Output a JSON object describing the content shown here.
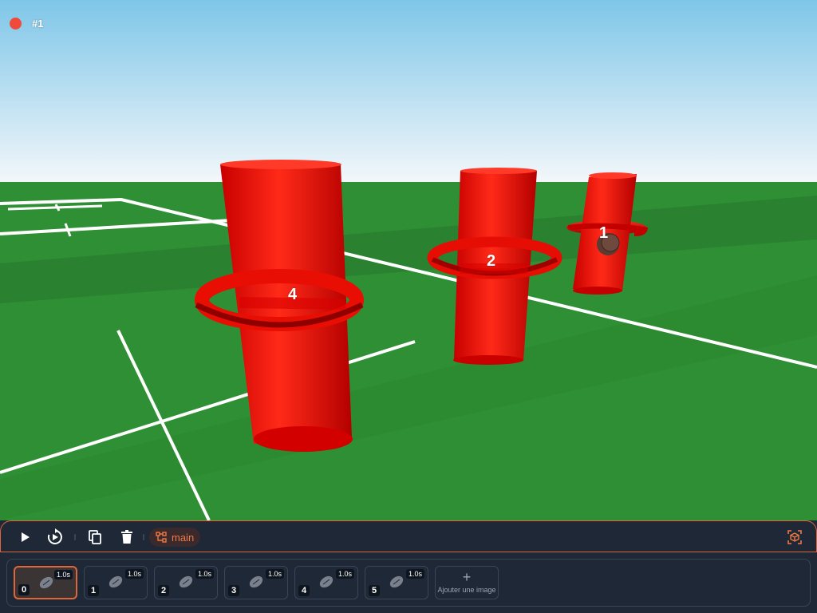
{
  "recording": {
    "label": "#1"
  },
  "scene": {
    "pole_labels": [
      "1",
      "2",
      "4"
    ],
    "colors": {
      "sky_top": "#7ec6e8",
      "sky_bottom": "#f3f7fa",
      "grass": "#2f8f34",
      "pole": "#ff1a10",
      "line": "#ffffff"
    }
  },
  "toolbar": {
    "play_icon": "play-icon",
    "replay_icon": "replay-icon",
    "duplicate_icon": "copy-icon",
    "delete_icon": "trash-icon",
    "branch_label": "main",
    "view3d_icon": "3d-view-icon"
  },
  "timeline": {
    "frames": [
      {
        "index": "0",
        "duration": "1.0s",
        "active": true
      },
      {
        "index": "1",
        "duration": "1.0s",
        "active": false
      },
      {
        "index": "2",
        "duration": "1.0s",
        "active": false
      },
      {
        "index": "3",
        "duration": "1.0s",
        "active": false
      },
      {
        "index": "4",
        "duration": "1.0s",
        "active": false
      },
      {
        "index": "5",
        "duration": "1.0s",
        "active": false
      }
    ],
    "add_label": "Ajouter une image",
    "add_icon": "plus-icon"
  },
  "accent_color": "#e0663a"
}
